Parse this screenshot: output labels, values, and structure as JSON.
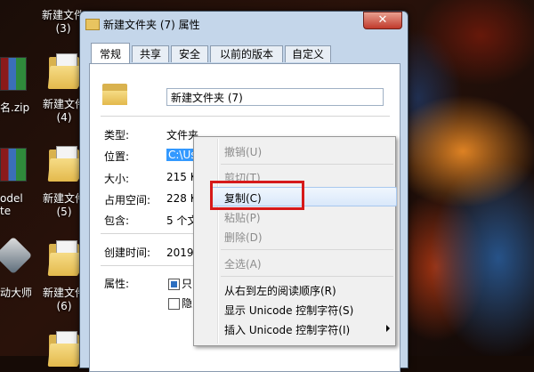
{
  "desktop": {
    "icons": [
      {
        "label_line1": "新建文件",
        "label_line2": "(3)"
      },
      {
        "label_line1": "新建文件",
        "label_line2": "(4)"
      },
      {
        "label_line1": "新建文件",
        "label_line2": "(5)"
      },
      {
        "label_line1": "新建文件",
        "label_line2": "(6)"
      }
    ],
    "left_fragments": [
      "名.zip",
      "odel",
      "te",
      "动大师"
    ]
  },
  "dialog": {
    "title": "新建文件夹 (7) 属性",
    "close": "✕",
    "tabs": [
      "常规",
      "共享",
      "安全",
      "以前的版本",
      "自定义"
    ],
    "folder_name": "新建文件夹 (7)",
    "rows": [
      {
        "label": "类型:",
        "value": "文件夹"
      },
      {
        "label": "位置:",
        "value": "C:\\Us"
      },
      {
        "label": "大小:",
        "value": "215 K"
      },
      {
        "label": "占用空间:",
        "value": "228 K"
      },
      {
        "label": "包含:",
        "value": "5 个文"
      },
      {
        "label": "创建时间:",
        "value": "2019年"
      }
    ],
    "attributes_label": "属性:",
    "attr1": "只",
    "attr2": "隐"
  },
  "context_menu": {
    "undo": "撤销(U)",
    "cut": "剪切(T)",
    "copy": "复制(C)",
    "paste": "粘贴(P)",
    "delete": "删除(D)",
    "select_all": "全选(A)",
    "rtl": "从右到左的阅读顺序(R)",
    "show_unicode": "显示 Unicode 控制字符(S)",
    "insert_unicode": "插入 Unicode 控制字符(I)"
  },
  "colors": {
    "highlight_box": "#d61a1a",
    "selection": "#3399ff"
  }
}
